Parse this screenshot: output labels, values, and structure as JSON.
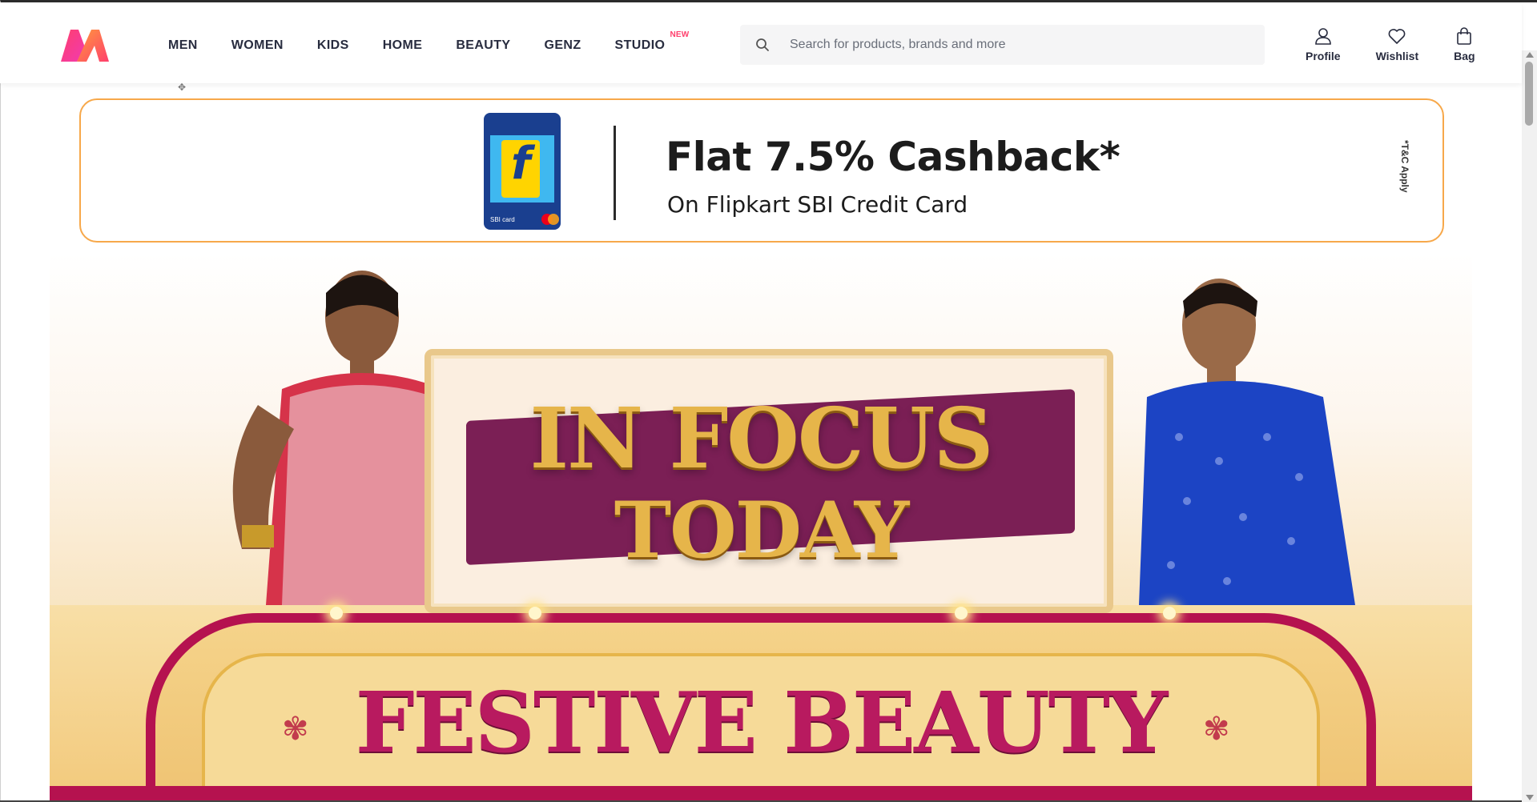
{
  "header": {
    "nav": [
      {
        "label": "MEN"
      },
      {
        "label": "WOMEN"
      },
      {
        "label": "KIDS"
      },
      {
        "label": "HOME"
      },
      {
        "label": "BEAUTY"
      },
      {
        "label": "GENZ"
      },
      {
        "label": "STUDIO",
        "badge": "NEW"
      }
    ],
    "search": {
      "placeholder": "Search for products, brands and more",
      "value": ""
    },
    "actions": {
      "profile": "Profile",
      "wishlist": "Wishlist",
      "bag": "Bag"
    }
  },
  "offer": {
    "title": "Flat 7.5% Cashback*",
    "subtitle": "On Flipkart SBI Credit Card",
    "tc": "*T&C Apply",
    "card_text": "SBI card"
  },
  "hero": {
    "line1": "IN FOCUS",
    "line2": "TODAY",
    "line3": "FESTIVE BEAUTY"
  },
  "colors": {
    "brand_pink": "#ff3f6c",
    "text_dark": "#282c3f",
    "offer_border": "#f7a84a",
    "festive_magenta": "#b81a5f",
    "gold": "#e6b54a"
  }
}
